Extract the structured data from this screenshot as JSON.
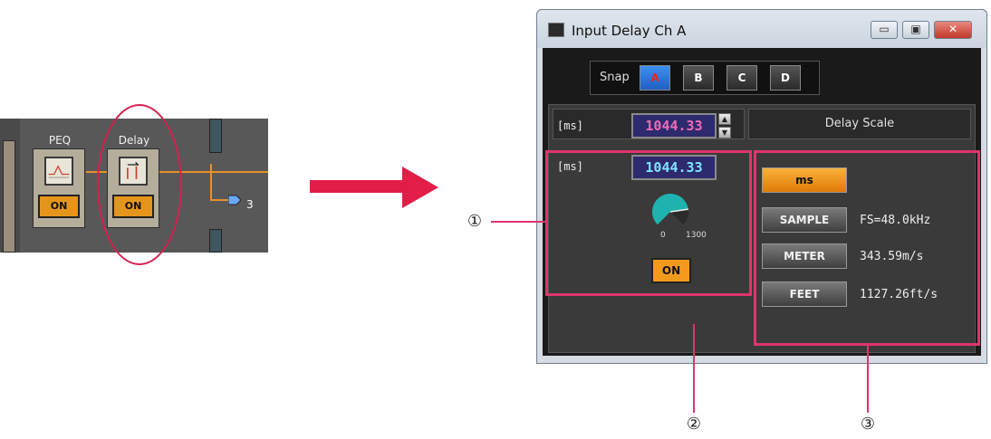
{
  "diagram": {
    "peq_label": "PEQ",
    "delay_label": "Delay",
    "peq_on": "ON",
    "delay_on": "ON",
    "output_number": "3"
  },
  "window": {
    "title": "Input Delay  Ch A",
    "minimize_glyph": "▭",
    "maximize_glyph": "▣",
    "close_glyph": "✕"
  },
  "snap": {
    "label": "Snap",
    "buttons": [
      "A",
      "B",
      "C",
      "D"
    ],
    "active": "A"
  },
  "delay": {
    "header": "Delay",
    "unit1": "[ms]",
    "unit2": "[ms]",
    "value1": "1044.33",
    "value2": "1044.33",
    "spin_up": "▲",
    "spin_down": "▼",
    "knob_min": "0",
    "knob_max": "1300",
    "knob_level": 0.803,
    "on_label": "ON"
  },
  "delay_scale": {
    "header": "Delay Scale",
    "buttons": [
      {
        "label": "ms",
        "value": ""
      },
      {
        "label": "SAMPLE",
        "value": "FS=48.0kHz"
      },
      {
        "label": "METER",
        "value": "343.59m/s"
      },
      {
        "label": "FEET",
        "value": "1127.26ft/s"
      }
    ],
    "active": "ms"
  },
  "callouts": [
    "①",
    "②",
    "③"
  ],
  "colors": {
    "accent_red": "#e0346a",
    "on_orange": "#f39a1c",
    "value_magenta": "#f06bb8",
    "value_cyan": "#7fe5ff",
    "knob_teal": "#1fb3b0"
  }
}
